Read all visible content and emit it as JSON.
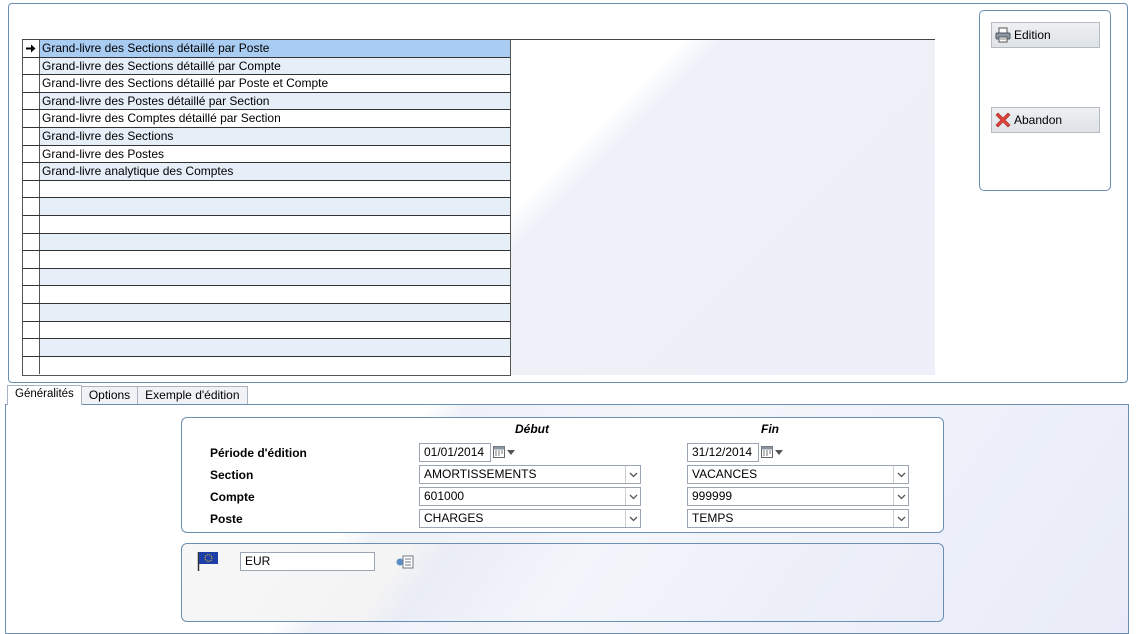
{
  "report_list": {
    "items": [
      "Grand-livre des Sections détaillé par Poste",
      "Grand-livre des Sections détaillé par Compte",
      "Grand-livre des Sections détaillé par Poste et Compte",
      "Grand-livre des Postes détaillé par Section",
      "Grand-livre des Comptes détaillé par Section",
      "Grand-livre des Sections",
      "Grand-livre des Postes",
      "Grand-livre analytique des Comptes",
      "",
      "",
      "",
      "",
      "",
      "",
      "",
      "",
      "",
      "",
      ""
    ]
  },
  "buttons": {
    "edition_label": "Edition",
    "abandon_label": "Abandon"
  },
  "tabs": [
    {
      "label": "Généralités"
    },
    {
      "label": "Options"
    },
    {
      "label": "Exemple d'édition"
    }
  ],
  "params": {
    "col_debut": "Début",
    "col_fin": "Fin",
    "periode_label": "Période d'édition",
    "section_label": "Section",
    "compte_label": "Compte",
    "poste_label": "Poste",
    "periode_debut": "01/01/2014",
    "periode_fin": "31/12/2014",
    "section_debut": "AMORTISSEMENTS",
    "section_fin": "VACANCES",
    "compte_debut": "601000",
    "compte_fin": "999999",
    "poste_debut": "CHARGES",
    "poste_fin": "TEMPS"
  },
  "currency": {
    "code": "EUR",
    "flag_icon": "eu-flag-icon"
  },
  "colors": {
    "selected_row": "#a9ccf2",
    "alt_row": "#e6eef8",
    "panel_border": "#6b8fb3"
  }
}
